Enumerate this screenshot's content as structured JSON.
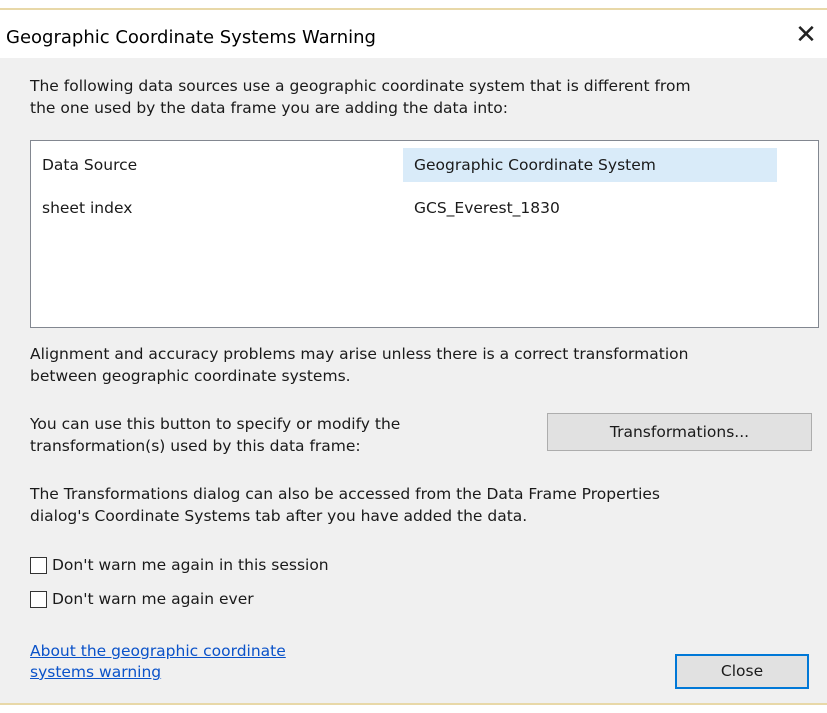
{
  "dialog": {
    "title": "Geographic Coordinate Systems Warning",
    "close_glyph": "✕"
  },
  "intro_text": {
    "line1": "The following data sources use a geographic coordinate system that is different from",
    "line2": "the one used by the data frame you are adding the data into:"
  },
  "table": {
    "columns": [
      "Data Source",
      "Geographic Coordinate System"
    ],
    "rows": [
      [
        "sheet index",
        "GCS_Everest_1830"
      ]
    ]
  },
  "alignment_text": {
    "line1": "Alignment and accuracy problems may arise unless there is a correct transformation",
    "line2": "between geographic coordinate systems."
  },
  "transform_text": {
    "line1": "You can use this button to specify or modify the",
    "line2": "transformation(s) used by this data frame:"
  },
  "transformations_button": "Transformations...",
  "access_text": {
    "line1": "The Transformations dialog can also be accessed from the Data Frame Properties",
    "line2": "dialog's Coordinate Systems tab after you have added the data."
  },
  "checkboxes": [
    {
      "label": "Don't warn me again in this session",
      "checked": false
    },
    {
      "label": "Don't warn me again ever",
      "checked": false
    }
  ],
  "help_link": {
    "line1": "About the geographic coordinate",
    "line2": "systems warning"
  },
  "close_button": "Close",
  "colors": {
    "header_highlight": "#d9ebf9",
    "link": "#0a52c9",
    "default_button_border": "#0078d7"
  }
}
